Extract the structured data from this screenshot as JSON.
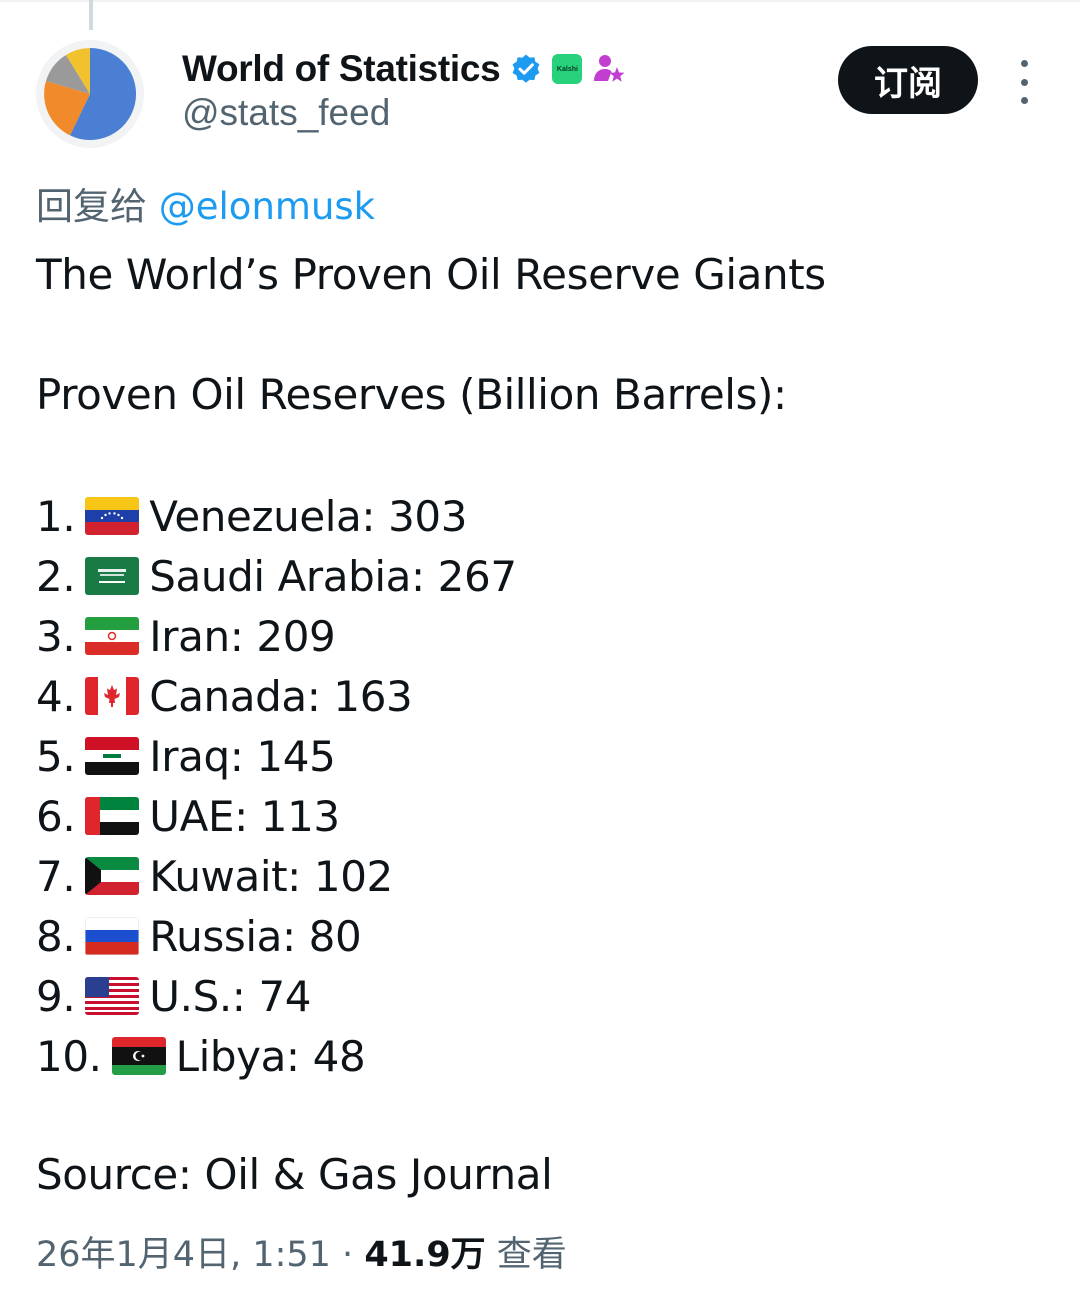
{
  "author": {
    "display_name": "World of Statistics",
    "handle": "@stats_feed",
    "affiliate_badge": "Kalshi",
    "icons": [
      "verified-badge-icon",
      "kalshi-affiliate-icon",
      "subscriber-star-icon"
    ]
  },
  "header": {
    "subscribe_label": "订阅"
  },
  "reply": {
    "prefix": "回复给",
    "mention": "@elonmusk"
  },
  "tweet": {
    "headline": "The World’s Proven Oil Reserve Giants",
    "subheading": "Proven Oil Reserves (Billion Barrels):",
    "items": [
      {
        "rank": "1.",
        "country": "Venezuela: 303",
        "flag": "venezuela-flag-icon"
      },
      {
        "rank": "2.",
        "country": "Saudi Arabia: 267",
        "flag": "saudi-arabia-flag-icon"
      },
      {
        "rank": "3.",
        "country": "Iran: 209",
        "flag": "iran-flag-icon"
      },
      {
        "rank": "4.",
        "country": "Canada: 163",
        "flag": "canada-flag-icon"
      },
      {
        "rank": "5.",
        "country": "Iraq: 145",
        "flag": "iraq-flag-icon"
      },
      {
        "rank": "6.",
        "country": "UAE: 113",
        "flag": "uae-flag-icon"
      },
      {
        "rank": "7.",
        "country": "Kuwait: 102",
        "flag": "kuwait-flag-icon"
      },
      {
        "rank": "8.",
        "country": "Russia: 80",
        "flag": "russia-flag-icon"
      },
      {
        "rank": "9.",
        "country": "U.S.: 74",
        "flag": "usa-flag-icon"
      },
      {
        "rank": "10.",
        "country": "Libya: 48",
        "flag": "libya-flag-icon"
      }
    ],
    "source": "Source: Oil & Gas Journal"
  },
  "meta": {
    "timestamp": "26年1月4日, 1:51",
    "separator": " · ",
    "views_count": "41.9万",
    "views_label": " 查看"
  },
  "colors": {
    "link_blue": "#1d9bf0",
    "secondary_text": "#536471",
    "primary_text": "#0f1419",
    "subscribe_bg": "#0f1419"
  }
}
